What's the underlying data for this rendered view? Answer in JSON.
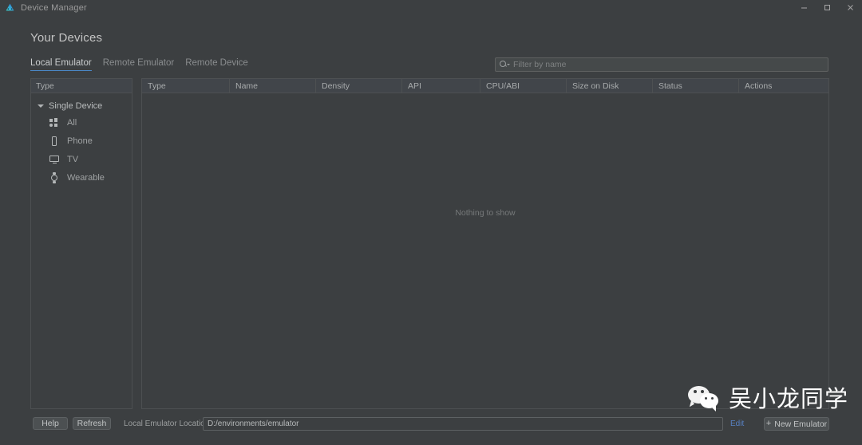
{
  "window": {
    "title": "Device Manager",
    "app_icon": "android-studio-icon",
    "controls": {
      "minimize": "minimize-icon",
      "maximize": "maximize-icon",
      "close": "close-icon"
    }
  },
  "header": {
    "page_title": "Your Devices"
  },
  "tabs": [
    {
      "label": "Local Emulator",
      "active": true
    },
    {
      "label": "Remote Emulator",
      "active": false
    },
    {
      "label": "Remote Device",
      "active": false
    }
  ],
  "filter": {
    "placeholder": "Filter by name",
    "value": "",
    "icon": "search-icon"
  },
  "tree": {
    "header": "Type",
    "group": {
      "label": "Single Device",
      "expanded": true
    },
    "items": [
      {
        "label": "All",
        "icon": "all-devices-icon"
      },
      {
        "label": "Phone",
        "icon": "phone-icon"
      },
      {
        "label": "TV",
        "icon": "tv-icon"
      },
      {
        "label": "Wearable",
        "icon": "watch-icon"
      }
    ]
  },
  "table": {
    "columns": [
      {
        "label": "Type",
        "width": 110
      },
      {
        "label": "Name",
        "width": 108
      },
      {
        "label": "Density",
        "width": 108
      },
      {
        "label": "API",
        "width": 98
      },
      {
        "label": "CPU/ABI",
        "width": 108
      },
      {
        "label": "Size on Disk",
        "width": 108
      },
      {
        "label": "Status",
        "width": 108
      },
      {
        "label": "Actions",
        "width": 112
      }
    ],
    "rows": [],
    "empty_message": "Nothing to show"
  },
  "bottom_bar": {
    "help_label": "Help",
    "refresh_label": "Refresh",
    "location_label": "Local Emulator Location:",
    "location_value": "D:/environments/emulator",
    "edit_label": "Edit",
    "new_emulator_label": "New Emulator",
    "new_emulator_plus": "+"
  },
  "watermark": {
    "text": "吴小龙同学",
    "logo": "wechat-logo"
  },
  "colors": {
    "background": "#3c3f41",
    "panel_header": "#41454a",
    "border": "#4d5052",
    "accent": "#4a88c7",
    "link": "#5881c4",
    "text": "#bbbbbb",
    "muted_text": "#76797a"
  }
}
